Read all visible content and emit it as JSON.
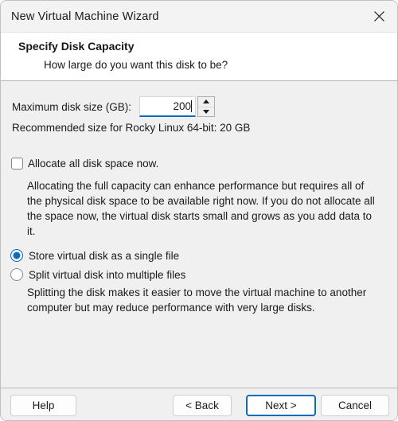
{
  "window": {
    "title": "New Virtual Machine Wizard",
    "close_icon": "close-icon"
  },
  "header": {
    "title": "Specify Disk Capacity",
    "subtitle": "How large do you want this disk to be?"
  },
  "body": {
    "disk_size": {
      "label": "Maximum disk size (GB):",
      "value": "200",
      "placeholder": "",
      "spinner_up_icon": "chevron-up-icon",
      "spinner_down_icon": "chevron-down-icon"
    },
    "recommendation": "Recommended size for Rocky Linux 64-bit: 20 GB",
    "allocate": {
      "label": "Allocate all disk space now.",
      "checked": false,
      "description": "Allocating the full capacity can enhance performance but requires all of the physical disk space to be available right now. If you do not allocate all the space now, the virtual disk starts small and grows as you add data to it."
    },
    "storage_options": {
      "single_label": "Store virtual disk as a single file",
      "split_label": "Split virtual disk into multiple files",
      "selected": "single",
      "description": "Splitting the disk makes it easier to move the virtual machine to another computer but may reduce performance with very large disks."
    }
  },
  "footer": {
    "help_label": "Help",
    "back_label": "< Back",
    "next_label": "Next >",
    "cancel_label": "Cancel"
  },
  "colors": {
    "accent": "#0f6cbd",
    "cursor_marker": "#ffe534",
    "body_bg": "#f0f0f0",
    "titlebar_bg": "#f3f3f3"
  }
}
